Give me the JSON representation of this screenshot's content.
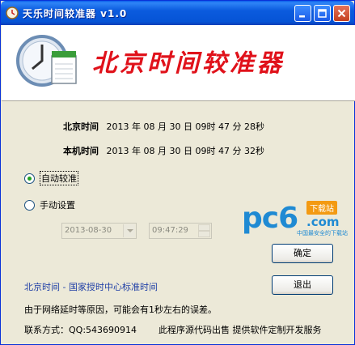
{
  "window": {
    "title": "天乐时间较准器 v1.0"
  },
  "banner": {
    "title": "北京时间较准器"
  },
  "times": {
    "beijing_label": "北京时间",
    "beijing_value": "2013 年 08 月 30 日  09时 47 分 28秒",
    "local_label": "本机时间",
    "local_value": "2013 年 08 月 30 日  09时 47 分 32秒"
  },
  "modes": {
    "auto_label": "自动较准",
    "manual_label": "手动设置",
    "selected": "auto"
  },
  "manual": {
    "date_value": "2013-08-30",
    "time_value": "09:47:29"
  },
  "buttons": {
    "ok_label": "确定",
    "exit_label": "退出"
  },
  "watermark": {
    "text": "pc6",
    "badge": "下载站",
    "domain": ".com",
    "tagline": "中国最安全的下载站"
  },
  "footer": {
    "link_text": "北京时间 - 国家授时中心标准时间",
    "note": "由于网络延时等原因，可能会有1秒左右的误差。",
    "contact": "联系方式：QQ:543690914",
    "ad": "此程序源代码出售  提供软件定制开发服务"
  },
  "colors": {
    "titlebar": "#0654d6",
    "banner_title": "#e0121b",
    "link": "#1f3fa6"
  }
}
